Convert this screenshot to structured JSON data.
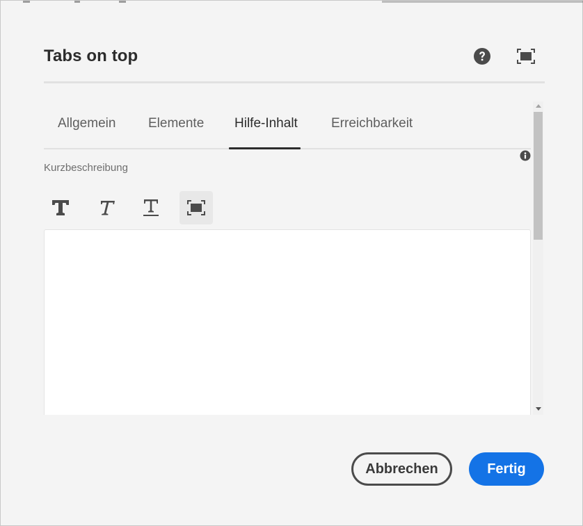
{
  "dialog": {
    "title": "Tabs on top",
    "help_icon": "help-circle-icon",
    "fullscreen_icon": "fullscreen-icon"
  },
  "tabs": [
    {
      "label": "Allgemein",
      "active": false
    },
    {
      "label": "Elemente",
      "active": false
    },
    {
      "label": "Hilfe-Inhalt",
      "active": true
    },
    {
      "label": "Erreichbarkeit",
      "active": false
    }
  ],
  "field": {
    "label": "Kurzbeschreibung",
    "info_icon": "info-icon",
    "value": ""
  },
  "rte_toolbar": [
    {
      "name": "bold-icon"
    },
    {
      "name": "italic-icon"
    },
    {
      "name": "underline-icon"
    },
    {
      "name": "fullscreen-icon",
      "selected": true
    }
  ],
  "footer": {
    "cancel_label": "Abbrechen",
    "done_label": "Fertig"
  },
  "colors": {
    "accent": "#1473e6",
    "background": "#f4f4f4",
    "text": "#2c2c2c"
  }
}
